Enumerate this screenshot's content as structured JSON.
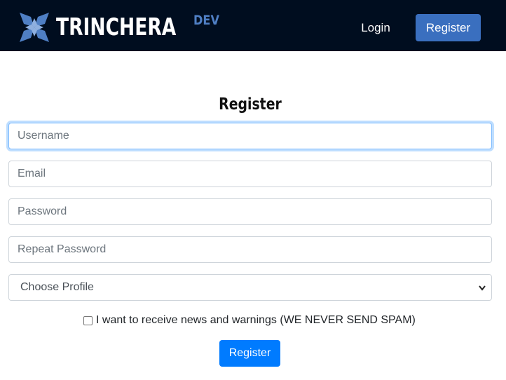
{
  "header": {
    "brand_name": "TRINCHERA",
    "brand_suffix": "DEV",
    "login_label": "Login",
    "register_label": "Register"
  },
  "form": {
    "title": "Register",
    "username_placeholder": "Username",
    "email_placeholder": "Email",
    "password_placeholder": "Password",
    "repeat_password_placeholder": "Repeat Password",
    "profile_select_value": "Choose Profile",
    "newsletter_label": "I want to receive news and warnings (WE NEVER SEND SPAM)",
    "newsletter_checked": false,
    "submit_label": "Register"
  },
  "colors": {
    "navbar_bg": "#000d1f",
    "brand_accent": "#4f7fc4",
    "nav_register_bg": "#3a6fbf",
    "submit_bg": "#007bff"
  }
}
